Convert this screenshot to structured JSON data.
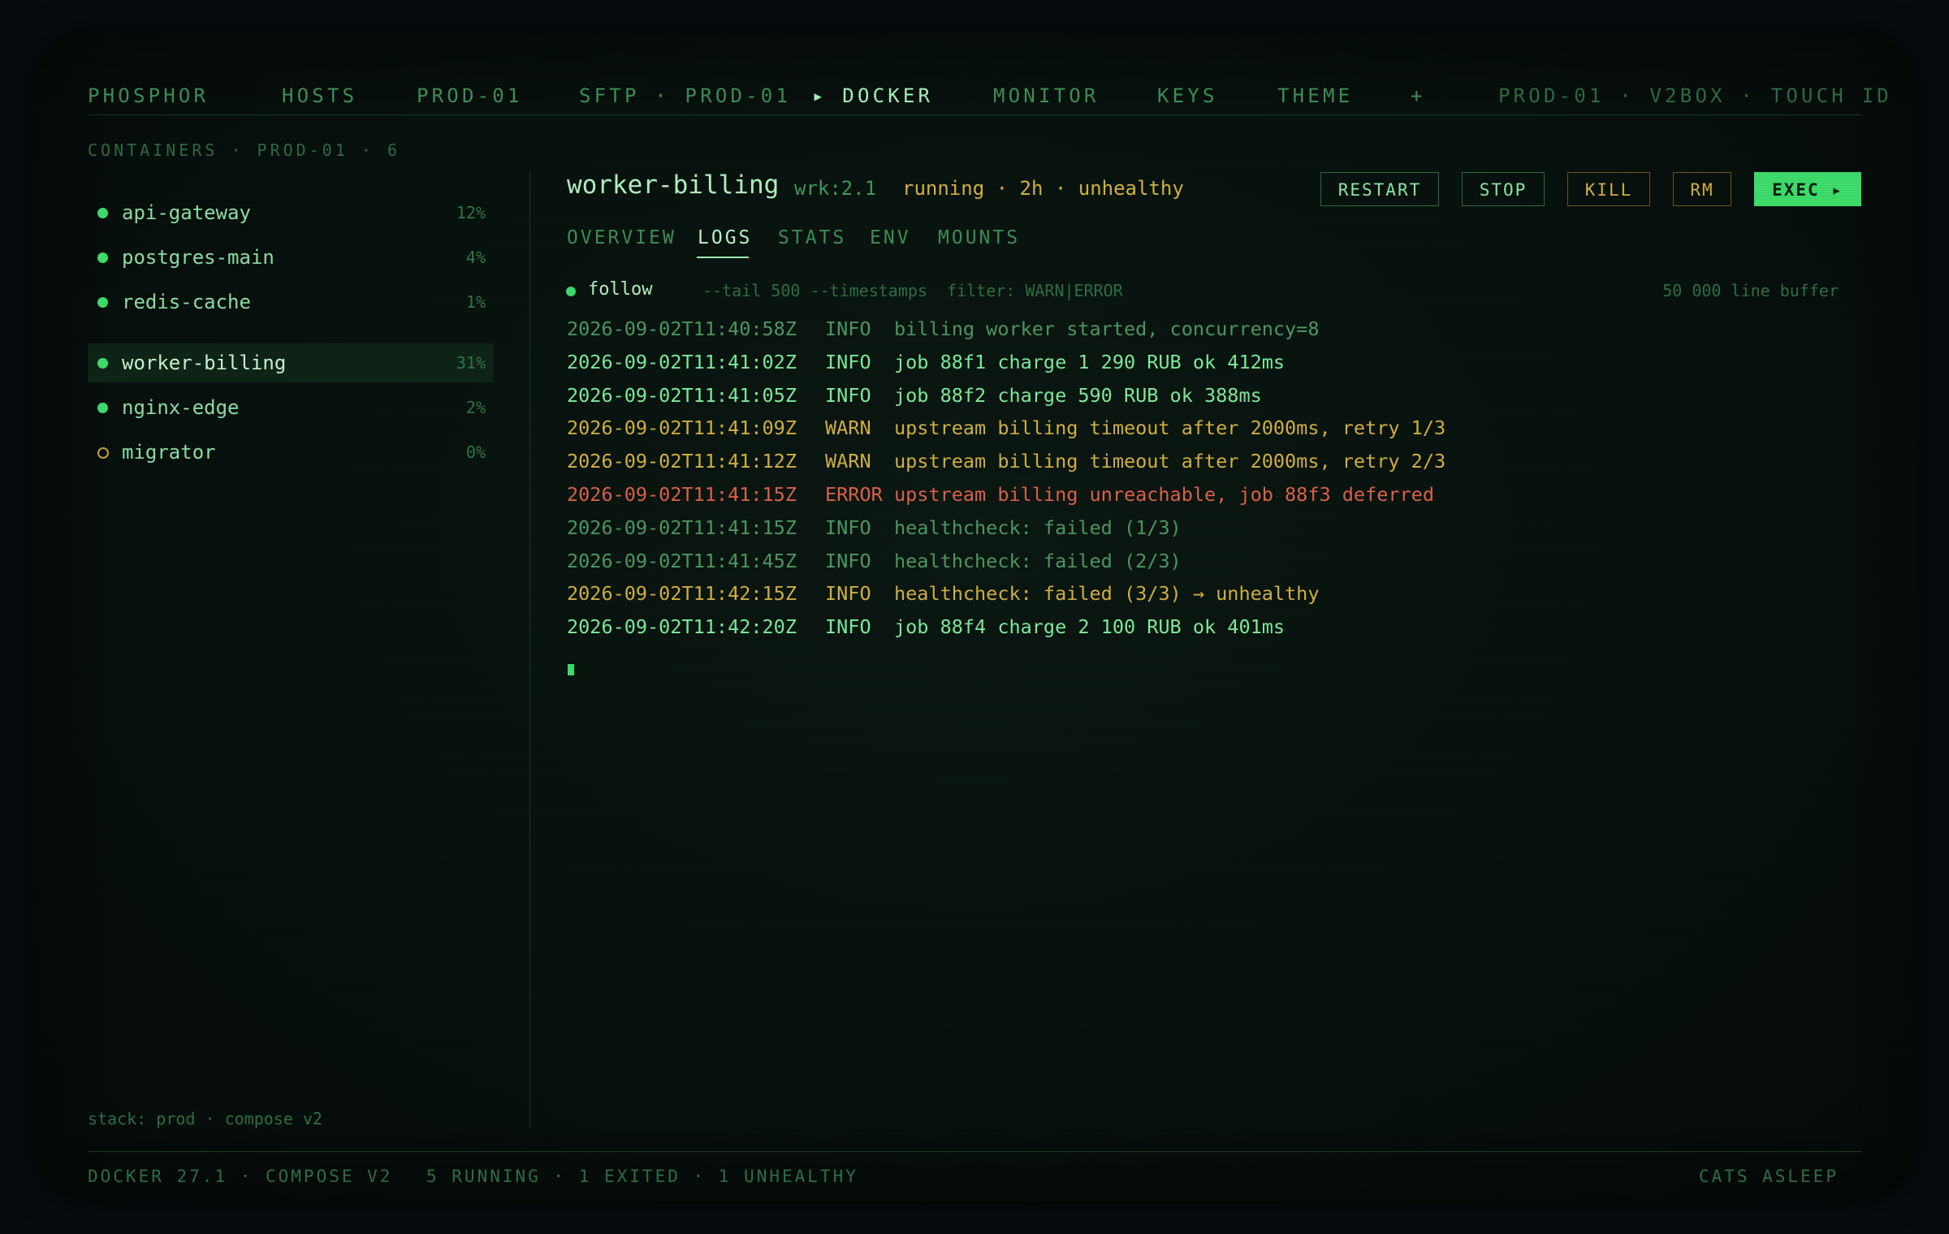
{
  "nav": {
    "brand": "PHOSPHOR",
    "items": [
      "HOSTS",
      "PROD-01",
      "SFTP · PROD-01",
      "▸ DOCKER",
      "MONITOR",
      "KEYS",
      "THEME",
      "+"
    ],
    "right": "PROD-01 · V2BOX · TOUCH ID"
  },
  "sidebar": {
    "heading": "CONTAINERS · PROD-01 · 6",
    "containers": [
      {
        "name": "api-gateway",
        "cpu": "12%",
        "state": "running"
      },
      {
        "name": "postgres-main",
        "cpu": "4%",
        "state": "running"
      },
      {
        "name": "redis-cache",
        "cpu": "1%",
        "state": "running"
      },
      {
        "name": "worker-billing",
        "cpu": "31%",
        "state": "running",
        "selected": true
      },
      {
        "name": "nginx-edge",
        "cpu": "2%",
        "state": "running"
      },
      {
        "name": "migrator",
        "cpu": "0%",
        "state": "exited"
      }
    ],
    "footer": "stack: prod · compose v2"
  },
  "detail": {
    "title": "worker-billing",
    "tag": "wrk:2.1",
    "status": "running · 2h · unhealthy",
    "buttons": {
      "restart": "RESTART",
      "stop": "STOP",
      "kill": "KILL",
      "rm": "RM",
      "exec": "EXEC ▸"
    },
    "tabs": [
      "OVERVIEW",
      "LOGS",
      "STATS",
      "ENV",
      "MOUNTS"
    ],
    "active_tab": "LOGS",
    "follow_label": "follow",
    "follow_args": "--tail 500 --timestamps  filter: WARN|ERROR",
    "buffer": "50 000 line buffer"
  },
  "logs": [
    {
      "ts": "2026-09-02T11:40:58Z",
      "level": "INFO",
      "msg": "billing worker started, concurrency=8",
      "tone": "dim"
    },
    {
      "ts": "2026-09-02T11:41:02Z",
      "level": "INFO",
      "msg": "job 88f1 charge 1 290 RUB ok 412ms",
      "tone": "ok"
    },
    {
      "ts": "2026-09-02T11:41:05Z",
      "level": "INFO",
      "msg": "job 88f2 charge 590 RUB ok 388ms",
      "tone": "ok"
    },
    {
      "ts": "2026-09-02T11:41:09Z",
      "level": "WARN",
      "msg": "upstream billing timeout after 2000ms, retry 1/3",
      "tone": "warn"
    },
    {
      "ts": "2026-09-02T11:41:12Z",
      "level": "WARN",
      "msg": "upstream billing timeout after 2000ms, retry 2/3",
      "tone": "warn"
    },
    {
      "ts": "2026-09-02T11:41:15Z",
      "level": "ERROR",
      "msg": "upstream billing unreachable, job 88f3 deferred",
      "tone": "err"
    },
    {
      "ts": "2026-09-02T11:41:15Z",
      "level": "INFO",
      "msg": "healthcheck: failed (1/3)",
      "tone": "dim"
    },
    {
      "ts": "2026-09-02T11:41:45Z",
      "level": "INFO",
      "msg": "healthcheck: failed (2/3)",
      "tone": "dim"
    },
    {
      "ts": "2026-09-02T11:42:15Z",
      "level": "INFO",
      "msg": "healthcheck: failed (3/3) → unhealthy",
      "tone": "warn"
    },
    {
      "ts": "2026-09-02T11:42:20Z",
      "level": "INFO",
      "msg": "job 88f4 charge 2 100 RUB ok 401ms",
      "tone": "ok"
    }
  ],
  "footer": {
    "left": "DOCKER 27.1 · COMPOSE V2",
    "middle": "5 RUNNING · 1 EXITED · 1 UNHEALTHY",
    "right": "CATS ASLEEP"
  },
  "colors": {
    "accent": "#3ee06c",
    "warn": "#d6b343",
    "error": "#e0634a",
    "background": "#07110d"
  }
}
